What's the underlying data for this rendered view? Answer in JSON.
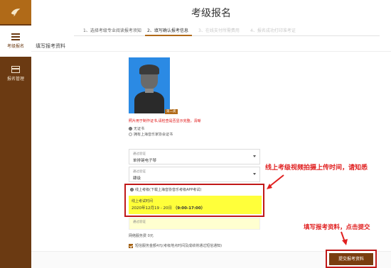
{
  "sidebar": {
    "items": [
      {
        "label": "考级报名"
      },
      {
        "label": "报名管理"
      }
    ]
  },
  "header": {
    "title": "考级报名",
    "steps": [
      {
        "label": "1、选择考级专业阅读报考须知"
      },
      {
        "label": "2、填写确认报考信息"
      },
      {
        "label": "3、在线支付所需费用"
      },
      {
        "label": "4、报名成功打印准考证"
      }
    ]
  },
  "form": {
    "section_title": "填写报考资料",
    "photo_badge": "第二类",
    "photo_warning": "照片用于制作证书,请检查是否显示完整。清晰",
    "cert_options": [
      {
        "label": "无证书",
        "checked": true
      },
      {
        "label": "拥有上海音乐家协会证书",
        "checked": false
      }
    ],
    "major_select": {
      "label": "通过验证",
      "value": "单排键电子琴"
    },
    "level_select": {
      "label": "通过验证",
      "value": "肆级"
    },
    "exam_method": "线上考级(下载上海音协音乐考级APP考试)",
    "exam_time_label": "线上考试时间",
    "exam_time_date": "2020年12月19 - 20日",
    "exam_time_hours": "（9:00-17:00）",
    "verify_label": "通过验证",
    "fee_label": "网络服务费 0元",
    "sms_option": "短信服务金额4元(考级地点时间及成绩将通过短信通知)",
    "sms_checked": true,
    "submit_label": "提交报考资料"
  },
  "annotations": {
    "note_1": "线上考级视频拍摄上传时间，请知悉",
    "note_2": "填写报考资料，点击提交",
    "color": "#e02020"
  },
  "colors": {
    "sidebar": "#6b3a12",
    "accent": "#b06a18",
    "highlight": "#ffff3a"
  }
}
